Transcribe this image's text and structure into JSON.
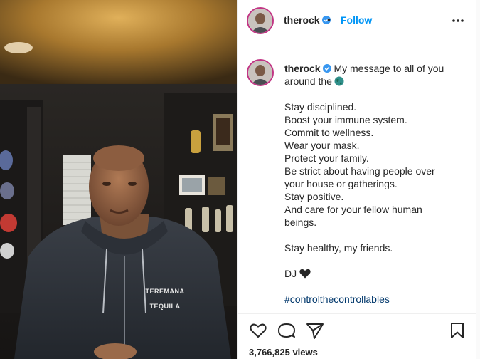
{
  "account": {
    "username": "therock",
    "follow_label": "Follow",
    "dot": "•"
  },
  "caption": {
    "username": "therock",
    "opening": "My message to all of you",
    "opening_2": "around the",
    "lines": [
      "Stay disciplined.",
      "Boost your immune system.",
      "Commit to wellness.",
      "Wear your mask.",
      "Protect your family.",
      "Be strict about having people over",
      "your house or gatherings.",
      "Stay positive.",
      "And care for your fellow human",
      "beings."
    ],
    "closing": "Stay healthy, my friends.",
    "signoff": "DJ",
    "hashtag": "#controlthecontrollables"
  },
  "media": {
    "shirt_text_1": "TEREMANA",
    "shirt_text_2": "TEQUILA"
  },
  "stats": {
    "views": "3,766,825 views"
  },
  "icons": {
    "verified": "verified-badge-icon",
    "more": "more-options-icon",
    "like": "heart-outline-icon",
    "comment": "comment-icon",
    "share": "paper-plane-icon",
    "save": "bookmark-icon"
  },
  "colors": {
    "link_blue": "#0095f6",
    "hashtag": "#00376b",
    "verified": "#3897f0"
  }
}
